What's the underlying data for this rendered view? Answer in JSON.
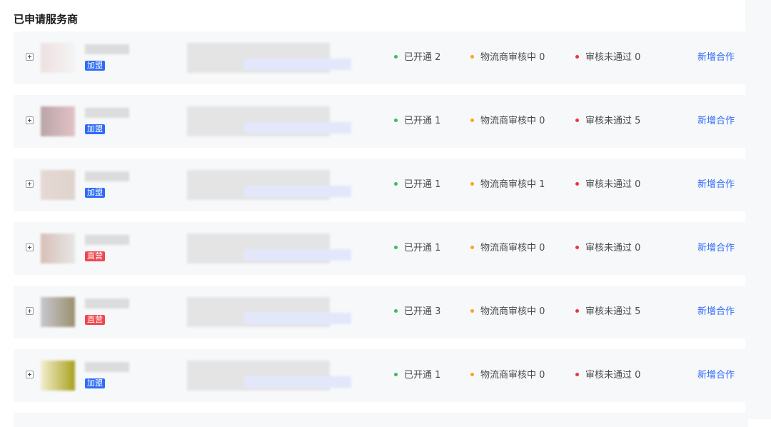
{
  "title": "已申请服务商",
  "colors": {
    "open": "#3dbb5a",
    "review": "#f5a623",
    "fail": "#e8373f",
    "accent": "#2f6cf6"
  },
  "stat_labels": {
    "open": "已开通",
    "review": "物流商审核中",
    "fail": "审核未通过"
  },
  "action_label": "新增合作",
  "providers": [
    {
      "tag": "加盟",
      "tag_type": "join",
      "open": "2",
      "review": "0",
      "fail": "0",
      "logo_colors": [
        "#eee0e0",
        "#f4f4f4"
      ]
    },
    {
      "tag": "加盟",
      "tag_type": "join",
      "open": "1",
      "review": "0",
      "fail": "5",
      "logo_colors": [
        "#b9a5a8",
        "#e2c2c6"
      ]
    },
    {
      "tag": "加盟",
      "tag_type": "join",
      "open": "1",
      "review": "1",
      "fail": "0",
      "logo_colors": [
        "#e6d8d5",
        "#ddd4cc"
      ]
    },
    {
      "tag": "直营",
      "tag_type": "direct",
      "open": "1",
      "review": "0",
      "fail": "0",
      "logo_colors": [
        "#d7bfb6",
        "#e6e6e6"
      ]
    },
    {
      "tag": "直营",
      "tag_type": "direct",
      "open": "3",
      "review": "0",
      "fail": "5",
      "logo_colors": [
        "#c7c8d0",
        "#9b9070"
      ]
    },
    {
      "tag": "加盟",
      "tag_type": "join",
      "open": "1",
      "review": "0",
      "fail": "0",
      "logo_colors": [
        "#f3eed0",
        "#a8a21e"
      ]
    }
  ]
}
